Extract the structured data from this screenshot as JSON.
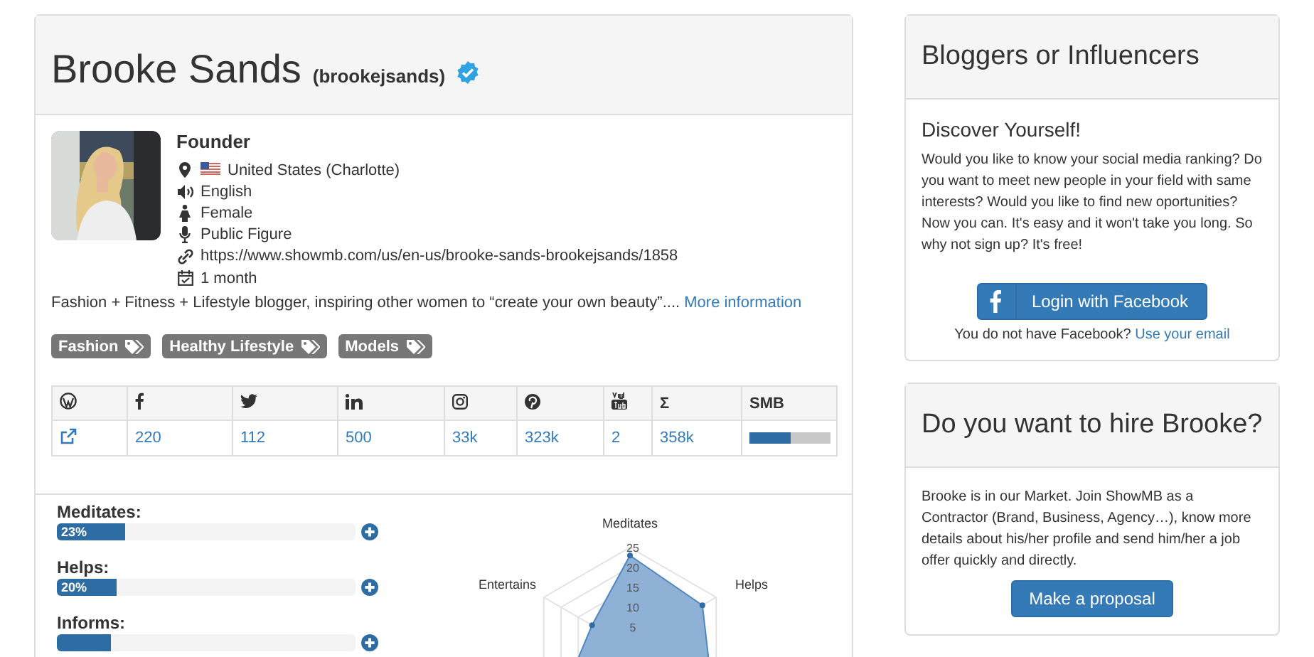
{
  "profile": {
    "name": "Brooke Sands",
    "handle": "(brookejsands)",
    "verified": true,
    "role": "Founder",
    "details": [
      {
        "kind": "location",
        "text": "United States (Charlotte)",
        "flag": true
      },
      {
        "kind": "language",
        "text": "English"
      },
      {
        "kind": "gender",
        "text": "Female"
      },
      {
        "kind": "category",
        "text": "Public Figure"
      },
      {
        "kind": "url",
        "text": "https://www.showmb.com/us/en-us/brooke-sands-brookejsands/1858"
      },
      {
        "kind": "calendar",
        "text": "1 month"
      }
    ],
    "bio": "Fashion + Fitness + Lifestyle blogger, inspiring other women to “create your own beauty”....",
    "more_link": "More information",
    "tags": [
      "Fashion",
      "Healthy Lifestyle",
      "Models"
    ]
  },
  "social_table": {
    "columns": [
      {
        "kind": "wordpress"
      },
      {
        "kind": "facebook"
      },
      {
        "kind": "twitter"
      },
      {
        "kind": "linkedin"
      },
      {
        "kind": "instagram"
      },
      {
        "kind": "pinterest"
      },
      {
        "kind": "youtube"
      },
      {
        "kind": "text",
        "label": "Σ"
      },
      {
        "kind": "text",
        "label": "SMB"
      }
    ],
    "row": [
      {
        "kind": "link"
      },
      {
        "kind": "text",
        "text": "220"
      },
      {
        "kind": "text",
        "text": "112"
      },
      {
        "kind": "text",
        "text": "500"
      },
      {
        "kind": "text",
        "text": "33k"
      },
      {
        "kind": "text",
        "text": "323k"
      },
      {
        "kind": "text",
        "text": "2"
      },
      {
        "kind": "text",
        "text": "358k"
      },
      {
        "kind": "meter",
        "level": 0.5
      }
    ]
  },
  "traits": [
    {
      "label": "Meditates:",
      "level": 0.23,
      "reading": "23%"
    },
    {
      "label": "Helps:",
      "level": 0.2,
      "reading": "20%"
    },
    {
      "label": "Informs:",
      "level": 0.18
    }
  ],
  "radar": {
    "axes": [
      {
        "label": "Meditates"
      },
      {
        "label": "Helps"
      },
      {
        "label": "Entertains"
      }
    ],
    "ticks": [
      "25",
      "20",
      "15",
      "10",
      "5"
    ]
  },
  "side_cards": [
    {
      "title": "Bloggers or Influencers",
      "subtitle": "Discover Yourself!",
      "text": "Would you like to know your social media ranking? Do you want to meet new people in your field with same interests? Would you like to find new oportunities? Now you can. It's easy and it won't take you long. So why not sign up? It's free!",
      "button": {
        "kind": "facebook",
        "label": "Login with Facebook"
      },
      "note": "You do not have Facebook?",
      "note_link": "Use your email"
    },
    {
      "title": "Do you want to hire Brooke?",
      "text": "Brooke is in our Market. Join ShowMB as a Contractor (Brand, Business, Agency…), know more details about his/her profile and send him/her a job offer quickly and directly.",
      "button": {
        "kind": "plain",
        "label": "Make a proposal"
      }
    }
  ]
}
